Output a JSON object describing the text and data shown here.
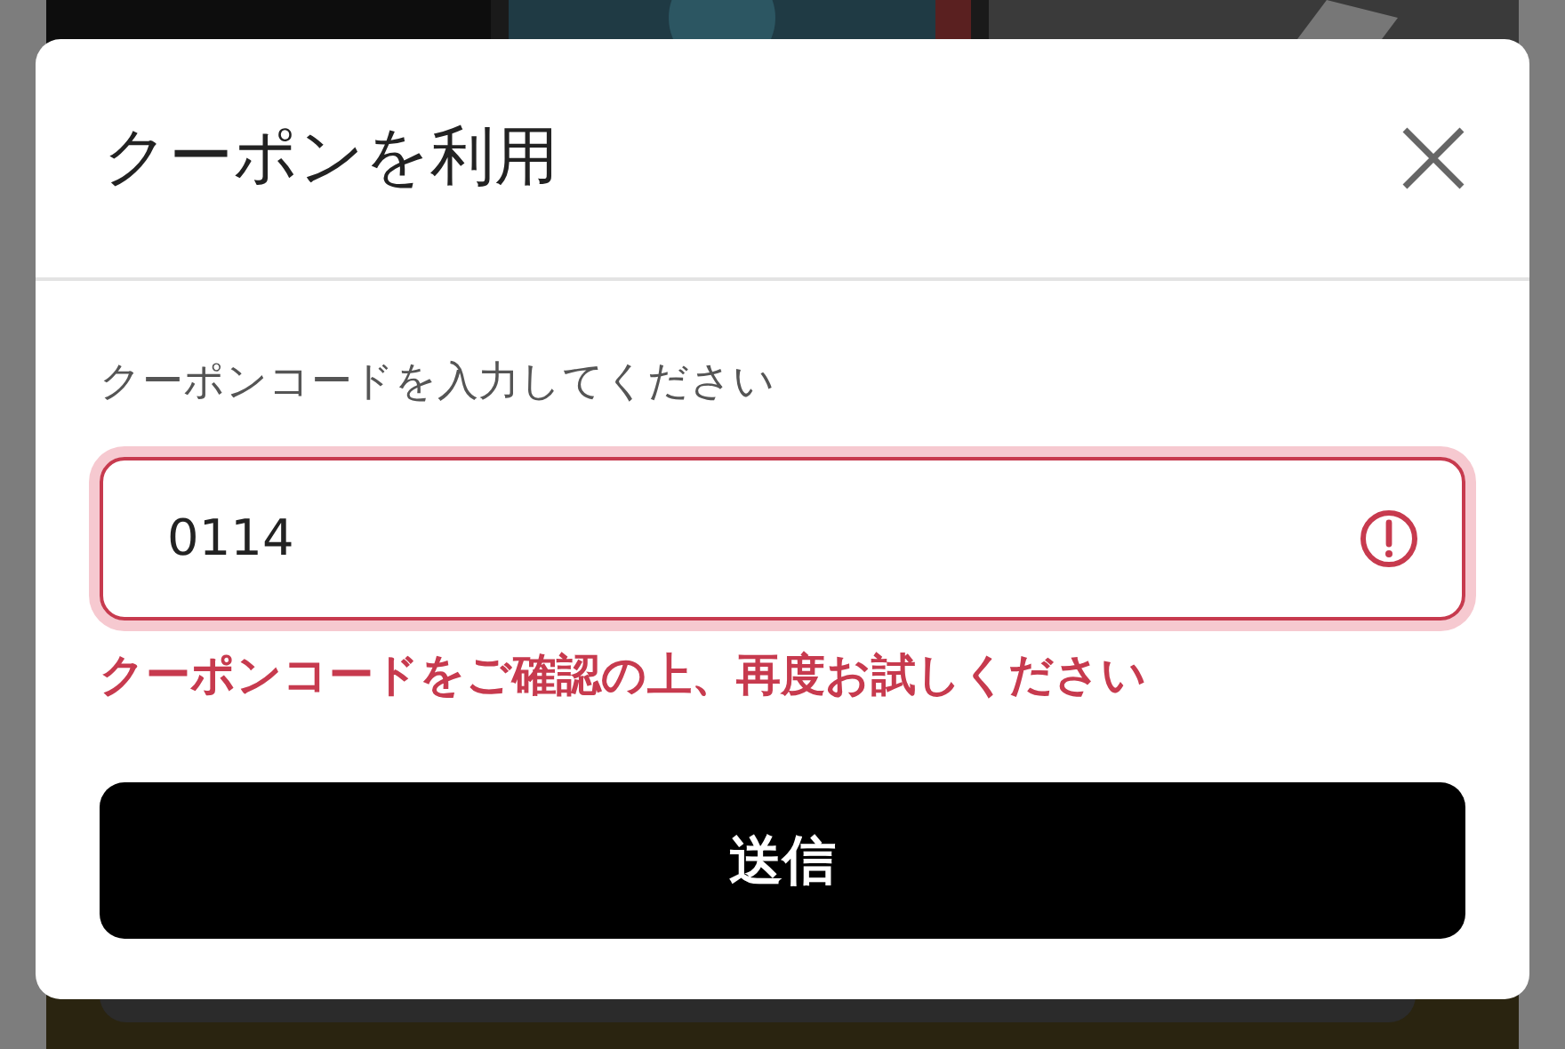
{
  "dialog": {
    "title": "クーポンを利用",
    "field": {
      "label": "クーポンコードを入力してください",
      "value": "0114",
      "error": true,
      "error_message": "クーポンコードをご確認の上、再度お試しください"
    },
    "submit": "送信"
  }
}
